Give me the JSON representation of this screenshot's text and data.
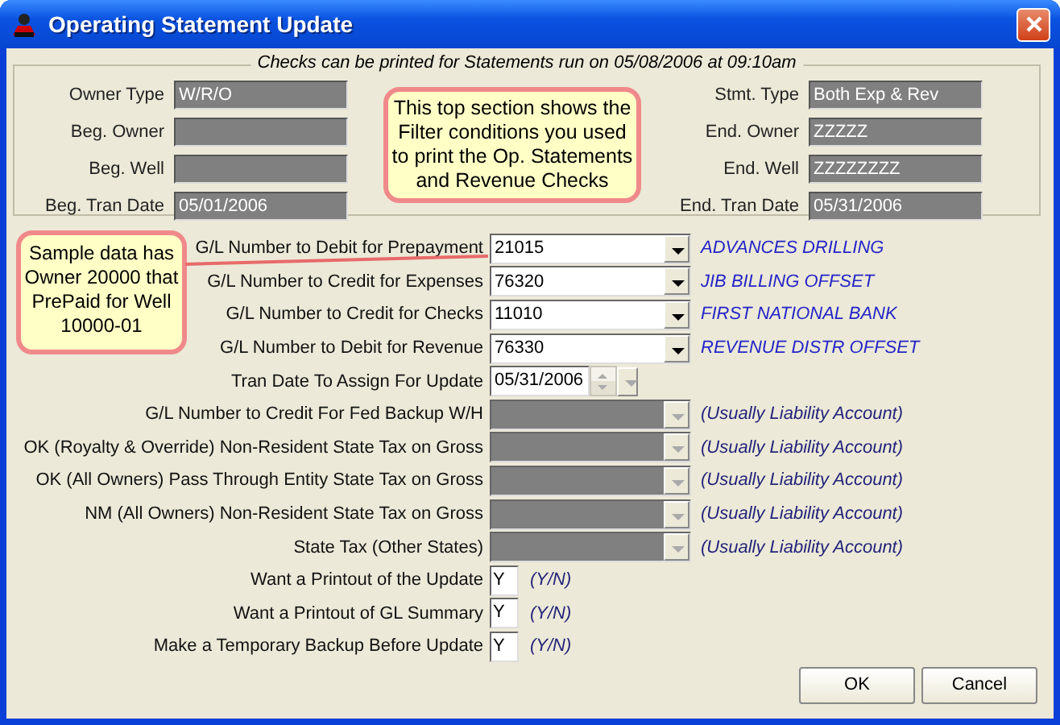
{
  "window": {
    "title": "Operating Statement Update"
  },
  "filter": {
    "legend": "Checks can be printed for Statements run on 05/08/2006 at 09:10am",
    "left": [
      {
        "label": "Owner Type",
        "value": "W/R/O"
      },
      {
        "label": "Beg. Owner"
      },
      {
        "label": "Beg. Well"
      },
      {
        "label": "Beg. Tran Date",
        "value": "05/01/2006"
      }
    ],
    "right": [
      {
        "label": "Stmt. Type",
        "value": "Both Exp & Rev"
      },
      {
        "label": "End. Owner",
        "value": "ZZZZZ"
      },
      {
        "label": "End. Well",
        "value": "ZZZZZZZZ"
      },
      {
        "label": "End. Tran Date",
        "value": "05/31/2006"
      }
    ],
    "note": "This top section shows the Filter conditions you used to print the Op. Statements and Revenue Checks"
  },
  "sample_note": "Sample data has Owner 20000 that PrePaid for Well 10000-01",
  "rows": [
    {
      "kind": "combo",
      "label": "G/L Number to Debit for Prepayment",
      "value": "21015",
      "description": "ADVANCES DRILLING",
      "disabled": false
    },
    {
      "kind": "combo",
      "label": "G/L Number to Credit for Expenses",
      "value": "76320",
      "description": "JIB BILLING OFFSET",
      "disabled": false
    },
    {
      "kind": "combo",
      "label": "G/L Number to Credit for Checks",
      "value": "11010",
      "description": "FIRST NATIONAL BANK",
      "disabled": false
    },
    {
      "kind": "combo",
      "label": "G/L Number to Debit for Revenue",
      "value": "76330",
      "description": "REVENUE DISTR OFFSET",
      "disabled": false
    },
    {
      "kind": "date",
      "label": "Tran Date To Assign For Update",
      "value": "05/31/2006"
    },
    {
      "kind": "combo",
      "label": "G/L Number to Credit For Fed Backup W/H",
      "description": "(Usually Liability Account)",
      "disabled": true
    },
    {
      "kind": "combo",
      "label": "OK (Royalty & Override) Non-Resident State Tax on Gross",
      "description": "(Usually Liability Account)",
      "disabled": true
    },
    {
      "kind": "combo",
      "label": "OK (All Owners) Pass Through Entity State Tax on Gross",
      "description": "(Usually Liability Account)",
      "disabled": true
    },
    {
      "kind": "combo",
      "label": "NM (All Owners) Non-Resident State Tax on Gross",
      "description": "(Usually Liability Account)",
      "disabled": true
    },
    {
      "kind": "combo",
      "label": "State Tax (Other States)",
      "description": "(Usually Liability Account)",
      "disabled": true
    },
    {
      "kind": "yn",
      "label": "Want a Printout of the Update",
      "value": "Y",
      "hint": "(Y/N)"
    },
    {
      "kind": "yn",
      "label": "Want a Printout of GL Summary",
      "value": "Y",
      "hint": "(Y/N)"
    },
    {
      "kind": "yn",
      "label": "Make a Temporary Backup Before Update",
      "value": "Y",
      "hint": "(Y/N)"
    }
  ],
  "buttons": [
    "OK",
    "Cancel"
  ]
}
